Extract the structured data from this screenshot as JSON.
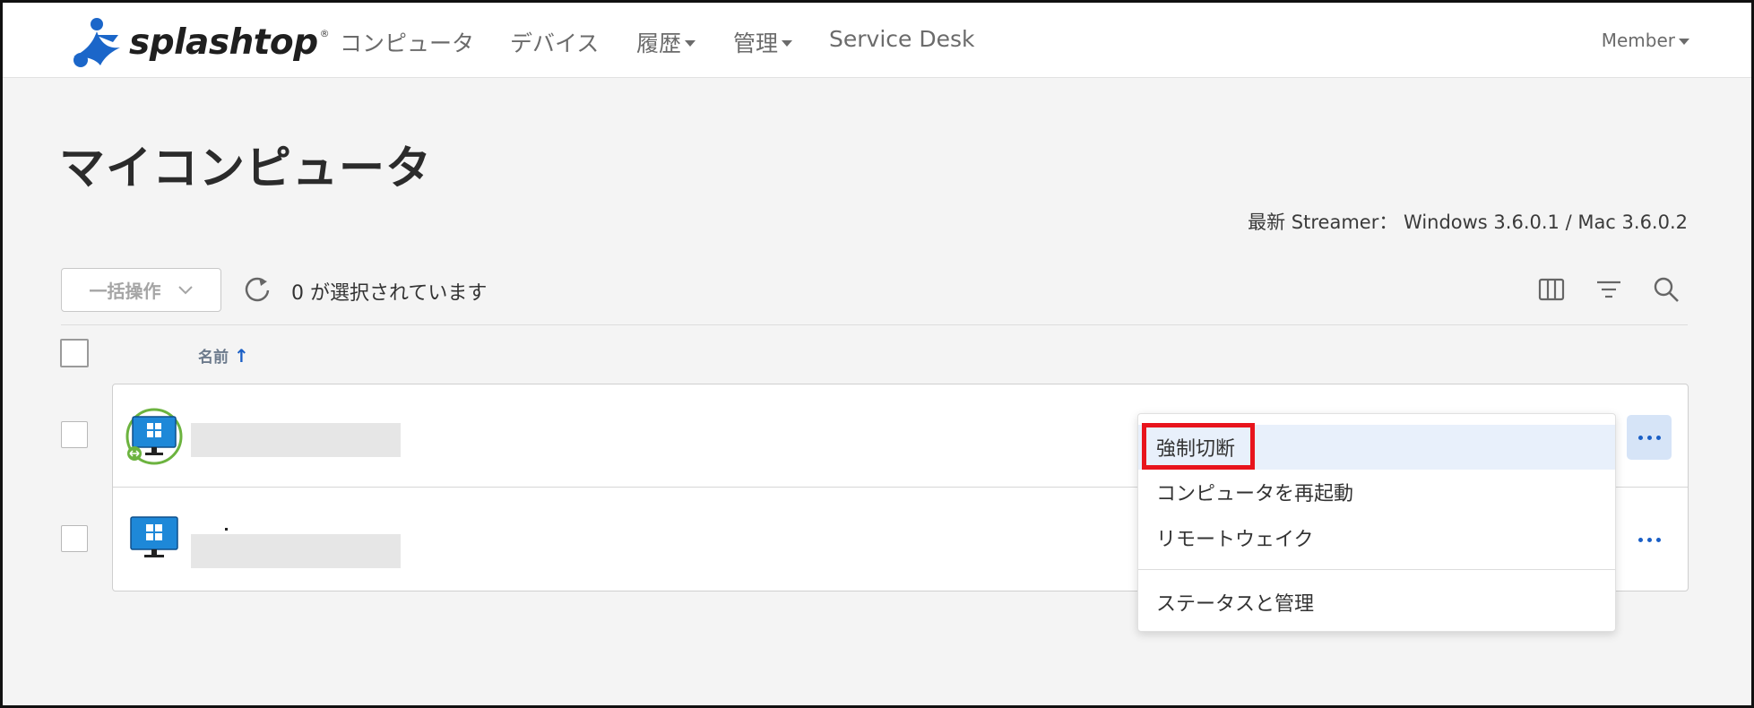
{
  "brand": {
    "name": "splashtop",
    "reg_mark": "®"
  },
  "nav": {
    "computers": "コンピュータ",
    "devices": "デバイス",
    "history": "履歴",
    "manage": "管理",
    "service_desk": "Service Desk",
    "member": "Member"
  },
  "page": {
    "title": "マイコンピュータ",
    "streamer_info": "最新 Streamer： Windows 3.6.0.1 / Mac 3.6.0.2"
  },
  "toolbar": {
    "bulk_label": "一括操作",
    "selected_text": "0 が選択されています",
    "icons": [
      "refresh-icon",
      "columns-icon",
      "filter-icon",
      "search-icon"
    ]
  },
  "table": {
    "name_header": "名前",
    "sort_indicator": "↑",
    "rows": [
      {
        "icon": "windows-computer-connected-icon",
        "name": "",
        "menu_open": true
      },
      {
        "icon": "windows-computer-icon",
        "name": "",
        "menu_open": false
      }
    ]
  },
  "row_menu": {
    "items": [
      "強制切断",
      "コンピュータを再起動",
      "リモートウェイク",
      "ステータスと管理"
    ],
    "highlighted": "強制切断"
  },
  "colors": {
    "accent_blue": "#1a5fc6",
    "highlight_red": "#e8141c",
    "menu_highlight": "#e8f0fb",
    "connected_green": "#6cb33f"
  }
}
